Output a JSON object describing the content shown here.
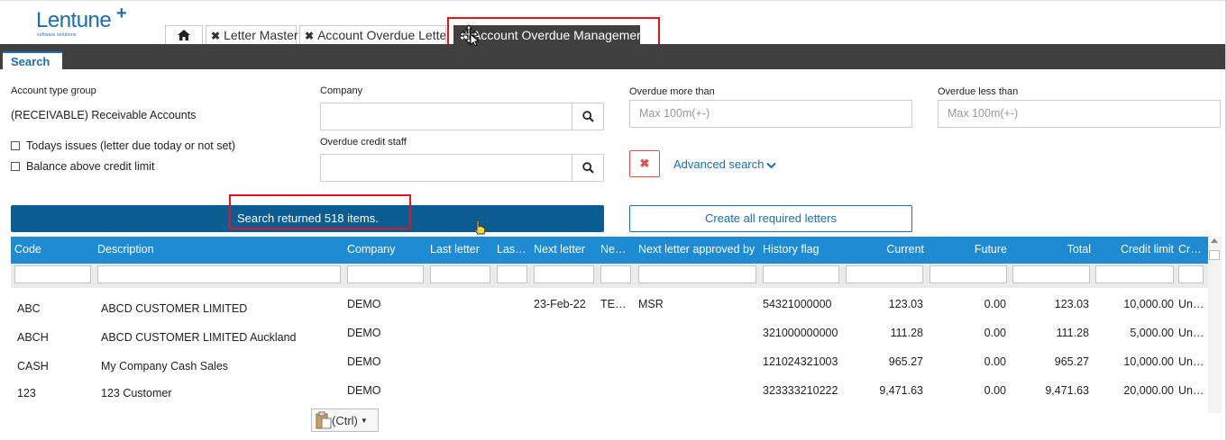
{
  "app": {
    "logo": "Lentune",
    "logo_plus": "+",
    "logo_sub": "software solutions"
  },
  "tabs": {
    "letter_master": "Letter Master",
    "account_overdue_letters": "Account Overdue Letters",
    "account_overdue_management": "Account Overdue Management",
    "close_glyph": "✖"
  },
  "search_tab": "Search",
  "filters": {
    "account_type_group_label": "Account type group",
    "account_type_group_value": "(RECEIVABLE) Receivable Accounts",
    "todays_issues_label": "Todays issues (letter due today or not set)",
    "balance_above_label": "Balance above credit limit",
    "company_label": "Company",
    "company_value": "",
    "overdue_staff_label": "Overdue credit staff",
    "overdue_staff_value": "",
    "overdue_more_label": "Overdue more than",
    "overdue_more_placeholder": "Max 100m(+-)",
    "overdue_less_label": "Overdue less than",
    "overdue_less_placeholder": "Max 100m(+-)",
    "clear_glyph": "✖",
    "advanced_search": "Advanced search"
  },
  "results": {
    "message": "Search returned 518 items.",
    "create_button": "Create all required letters"
  },
  "grid": {
    "headers": {
      "code": "Code",
      "description": "Description",
      "company": "Company",
      "last_letter": "Last letter",
      "last_letter_2": "Last letter date",
      "next_letter": "Next letter",
      "next_letter_2": "Next letter by",
      "next_approved_by": "Next letter approved by",
      "history_flag": "History flag",
      "current": "Current",
      "future": "Future",
      "total": "Total",
      "credit_limit": "Credit limit",
      "credit_terms": "Credit terms"
    },
    "rows": [
      {
        "code": "ABC",
        "description": "ABCD CUSTOMER LIMITED",
        "company": "DEMO",
        "last_letter": "",
        "last_letter_2": "",
        "next_letter": "23-Feb-22",
        "next_letter_2": "TESTING",
        "next_approved_by": "MSR",
        "history_flag": "54321000000",
        "current": "123.03",
        "future": "0.00",
        "total": "123.03",
        "credit_limit": "10,000.00",
        "credit_terms": "Unknown"
      },
      {
        "code": "ABCH",
        "description": "ABCD CUSTOMER LIMITED Auckland",
        "company": "DEMO",
        "last_letter": "",
        "last_letter_2": "",
        "next_letter": "",
        "next_letter_2": "",
        "next_approved_by": "",
        "history_flag": "321000000000",
        "current": "111.28",
        "future": "0.00",
        "total": "111.28",
        "credit_limit": "5,000.00",
        "credit_terms": "Unknown"
      },
      {
        "code": "CASH",
        "description": "My Company Cash Sales",
        "company": "DEMO",
        "last_letter": "",
        "last_letter_2": "",
        "next_letter": "",
        "next_letter_2": "",
        "next_approved_by": "",
        "history_flag": "121024321003",
        "current": "965.27",
        "future": "0.00",
        "total": "965.27",
        "credit_limit": "10,000.00",
        "credit_terms": "Unknown"
      },
      {
        "code": "123",
        "description": "123 Customer",
        "company": "DEMO",
        "last_letter": "",
        "last_letter_2": "",
        "next_letter": "",
        "next_letter_2": "",
        "next_approved_by": "",
        "history_flag": "323333210222",
        "current": "9,471.63",
        "future": "0.00",
        "total": "9,471.63",
        "credit_limit": "20,000.00",
        "credit_terms": "Unknown"
      }
    ]
  },
  "paste_popup": {
    "label": "(Ctrl)",
    "arrow": "▼"
  }
}
